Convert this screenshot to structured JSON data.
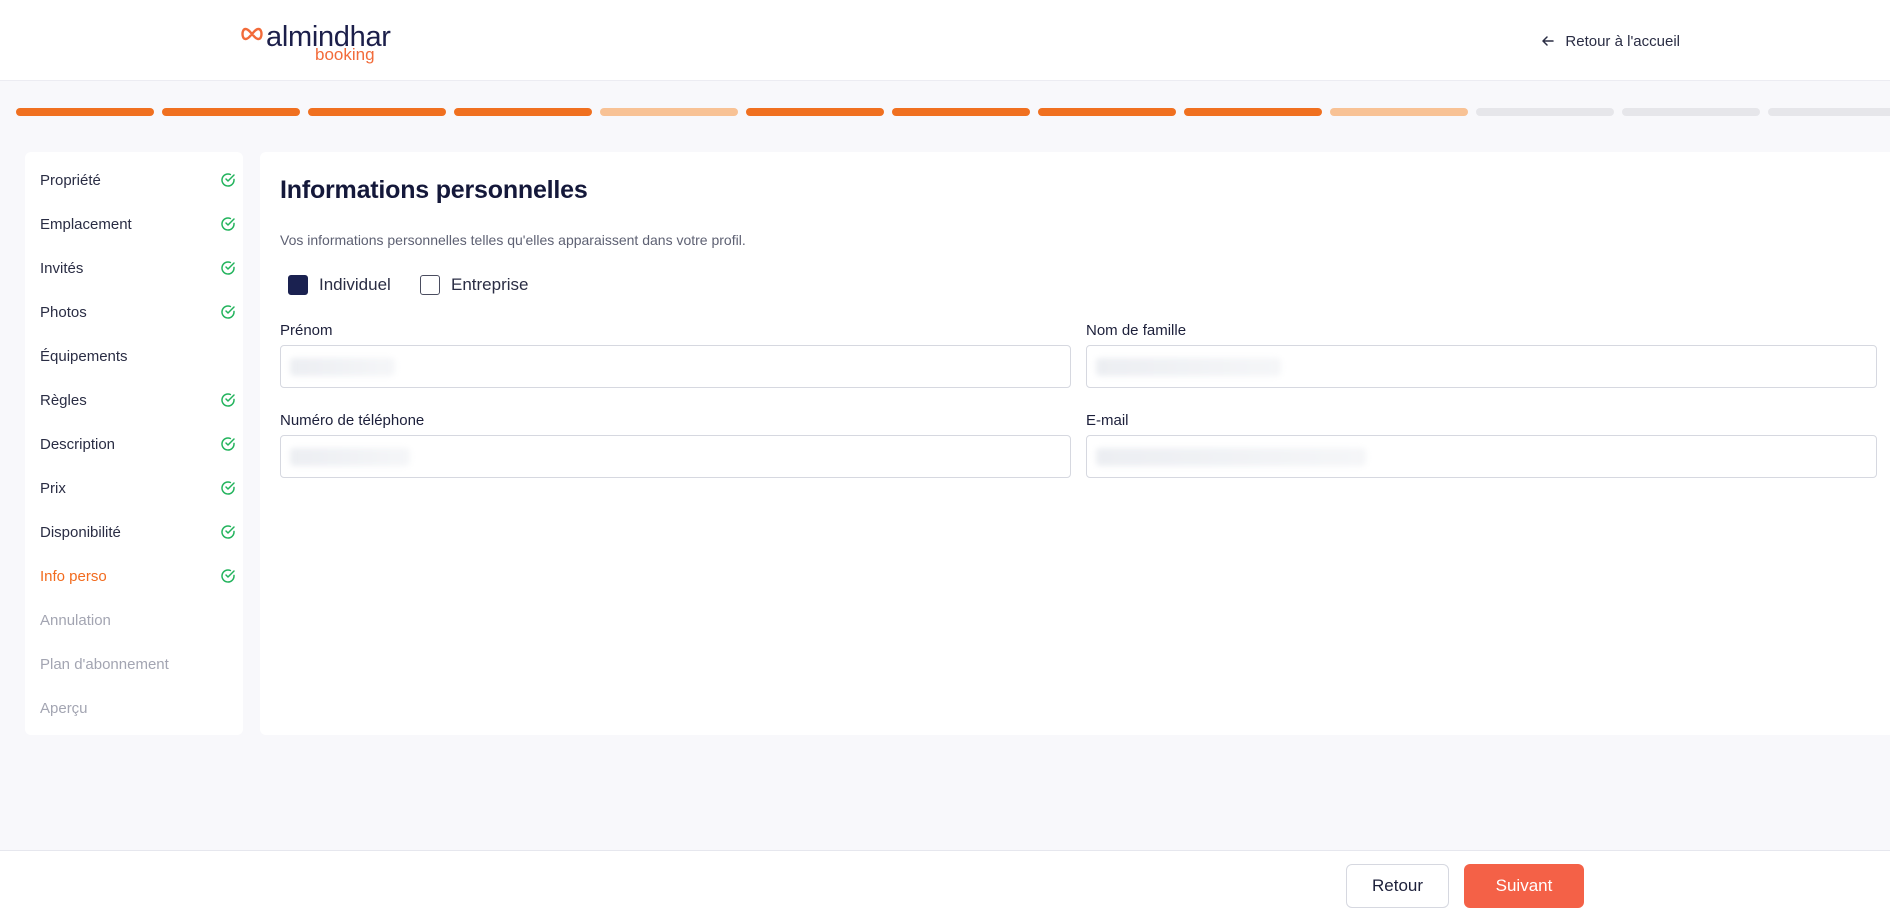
{
  "header": {
    "logo_word": "almindhar",
    "logo_sub": "booking",
    "back_home": "Retour à l'accueil"
  },
  "progress": {
    "steps": [
      "done",
      "done",
      "done",
      "done",
      "partial",
      "done",
      "done",
      "done",
      "done",
      "partial",
      "todo",
      "todo",
      "todo"
    ]
  },
  "sidebar": {
    "items": [
      {
        "label": "Propriété",
        "state": "complete"
      },
      {
        "label": "Emplacement",
        "state": "complete"
      },
      {
        "label": "Invités",
        "state": "complete"
      },
      {
        "label": "Photos",
        "state": "complete"
      },
      {
        "label": "Équipements",
        "state": "none"
      },
      {
        "label": "Règles",
        "state": "complete"
      },
      {
        "label": "Description",
        "state": "complete"
      },
      {
        "label": "Prix",
        "state": "complete"
      },
      {
        "label": "Disponibilité",
        "state": "complete"
      },
      {
        "label": "Info perso",
        "state": "active"
      },
      {
        "label": "Annulation",
        "state": "pending"
      },
      {
        "label": "Plan d'abonnement",
        "state": "pending"
      },
      {
        "label": "Aperçu",
        "state": "pending"
      }
    ]
  },
  "main": {
    "title": "Informations personnelles",
    "description": "Vos informations personnelles telles qu'elles apparaissent dans votre profil.",
    "type_options": [
      {
        "label": "Individuel",
        "checked": true
      },
      {
        "label": "Entreprise",
        "checked": false
      }
    ],
    "fields": {
      "first_name": {
        "label": "Prénom"
      },
      "last_name": {
        "label": "Nom de famille"
      },
      "phone": {
        "label": "Numéro de téléphone"
      },
      "email": {
        "label": "E-mail"
      }
    }
  },
  "footer": {
    "back_label": "Retour",
    "next_label": "Suivant"
  },
  "colors": {
    "accent": "#f07020",
    "accent_light": "#f8c295",
    "success": "#22b35c",
    "primary_button": "#f46147",
    "navy": "#1a2150"
  }
}
